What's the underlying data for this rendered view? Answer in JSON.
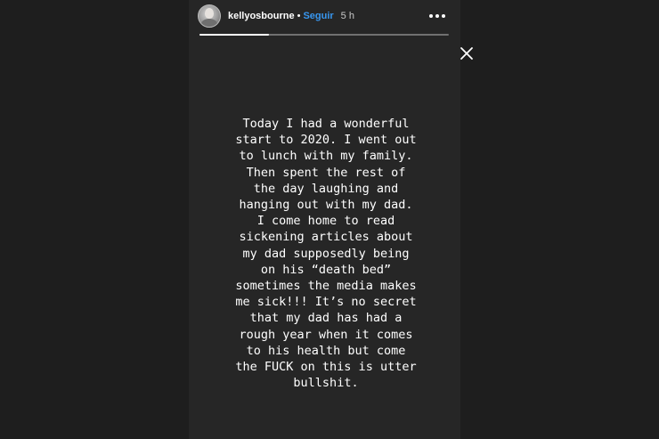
{
  "story": {
    "username": "kellyosbourne",
    "separator": "•",
    "follow_label": "Seguir",
    "time_ago": "5 h",
    "progress": 0.28,
    "text": "Today I had a wonderful\nstart to 2020. I went out\nto lunch with my family.\nThen spent the rest of\nthe day laughing and\nhanging out with my dad.\nI come home to read\nsickening articles about\nmy dad supposedly being\non his “death bed”\nsometimes the media makes\nme sick!!! It’s no secret\nthat my dad has had a\nrough year when it comes\nto his health but come\nthe FUCK on this is utter\nbullshit."
  },
  "icons": {
    "avatar": "profile-avatar",
    "more": "more-options-icon",
    "close": "close-icon"
  },
  "colors": {
    "background": "#1e1e1e",
    "story_background": "#262626",
    "follow": "#3897f0",
    "text": "#ffffff"
  }
}
